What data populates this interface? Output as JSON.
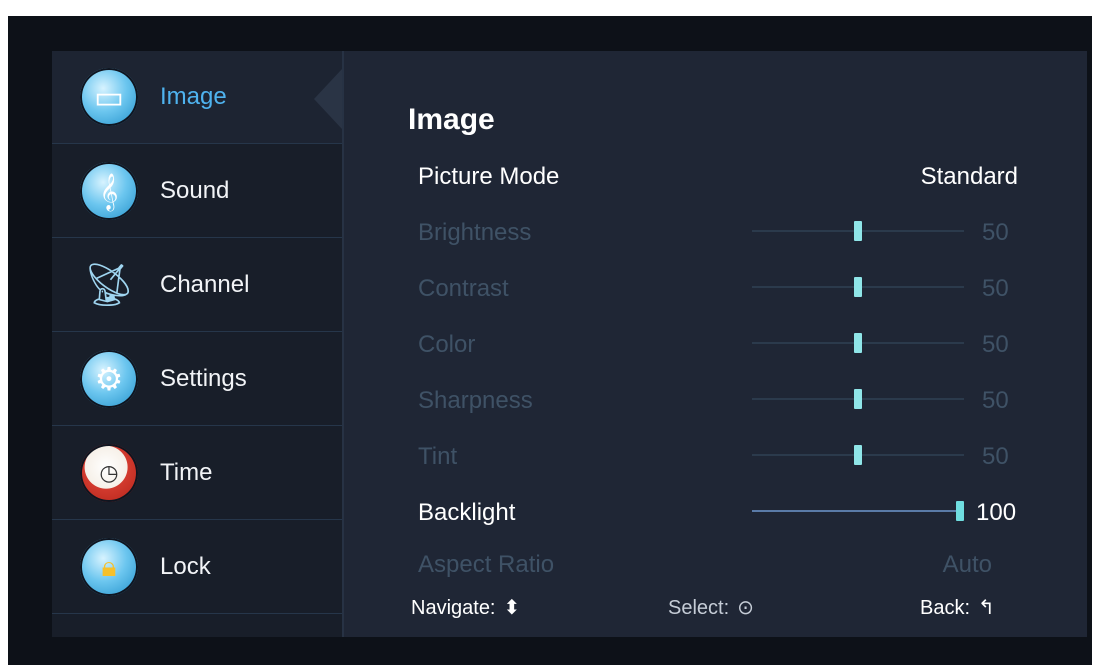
{
  "sidebar": {
    "items": [
      {
        "label": "Image",
        "icon": "monitor-icon",
        "active": true
      },
      {
        "label": "Sound",
        "icon": "treble-clef-icon"
      },
      {
        "label": "Channel",
        "icon": "satellite-dish-icon"
      },
      {
        "label": "Settings",
        "icon": "gear-icon"
      },
      {
        "label": "Time",
        "icon": "alarm-clock-icon"
      },
      {
        "label": "Lock",
        "icon": "padlock-icon"
      }
    ]
  },
  "panel": {
    "title": "Image",
    "picture_mode": {
      "label": "Picture Mode",
      "value": "Standard"
    },
    "brightness": {
      "label": "Brightness",
      "value": 50
    },
    "contrast": {
      "label": "Contrast",
      "value": 50
    },
    "color": {
      "label": "Color",
      "value": 50
    },
    "sharpness": {
      "label": "Sharpness",
      "value": 50
    },
    "tint": {
      "label": "Tint",
      "value": 50
    },
    "backlight": {
      "label": "Backlight",
      "value": 100
    },
    "aspect_ratio": {
      "label": "Aspect Ratio",
      "value": "Auto"
    }
  },
  "footer": {
    "navigate": "Navigate:",
    "select": "Select:",
    "back": "Back:"
  },
  "colors": {
    "accent": "#4fb3ef",
    "slider_thumb": "#6fdde0",
    "panel_bg": "#1f2635"
  }
}
